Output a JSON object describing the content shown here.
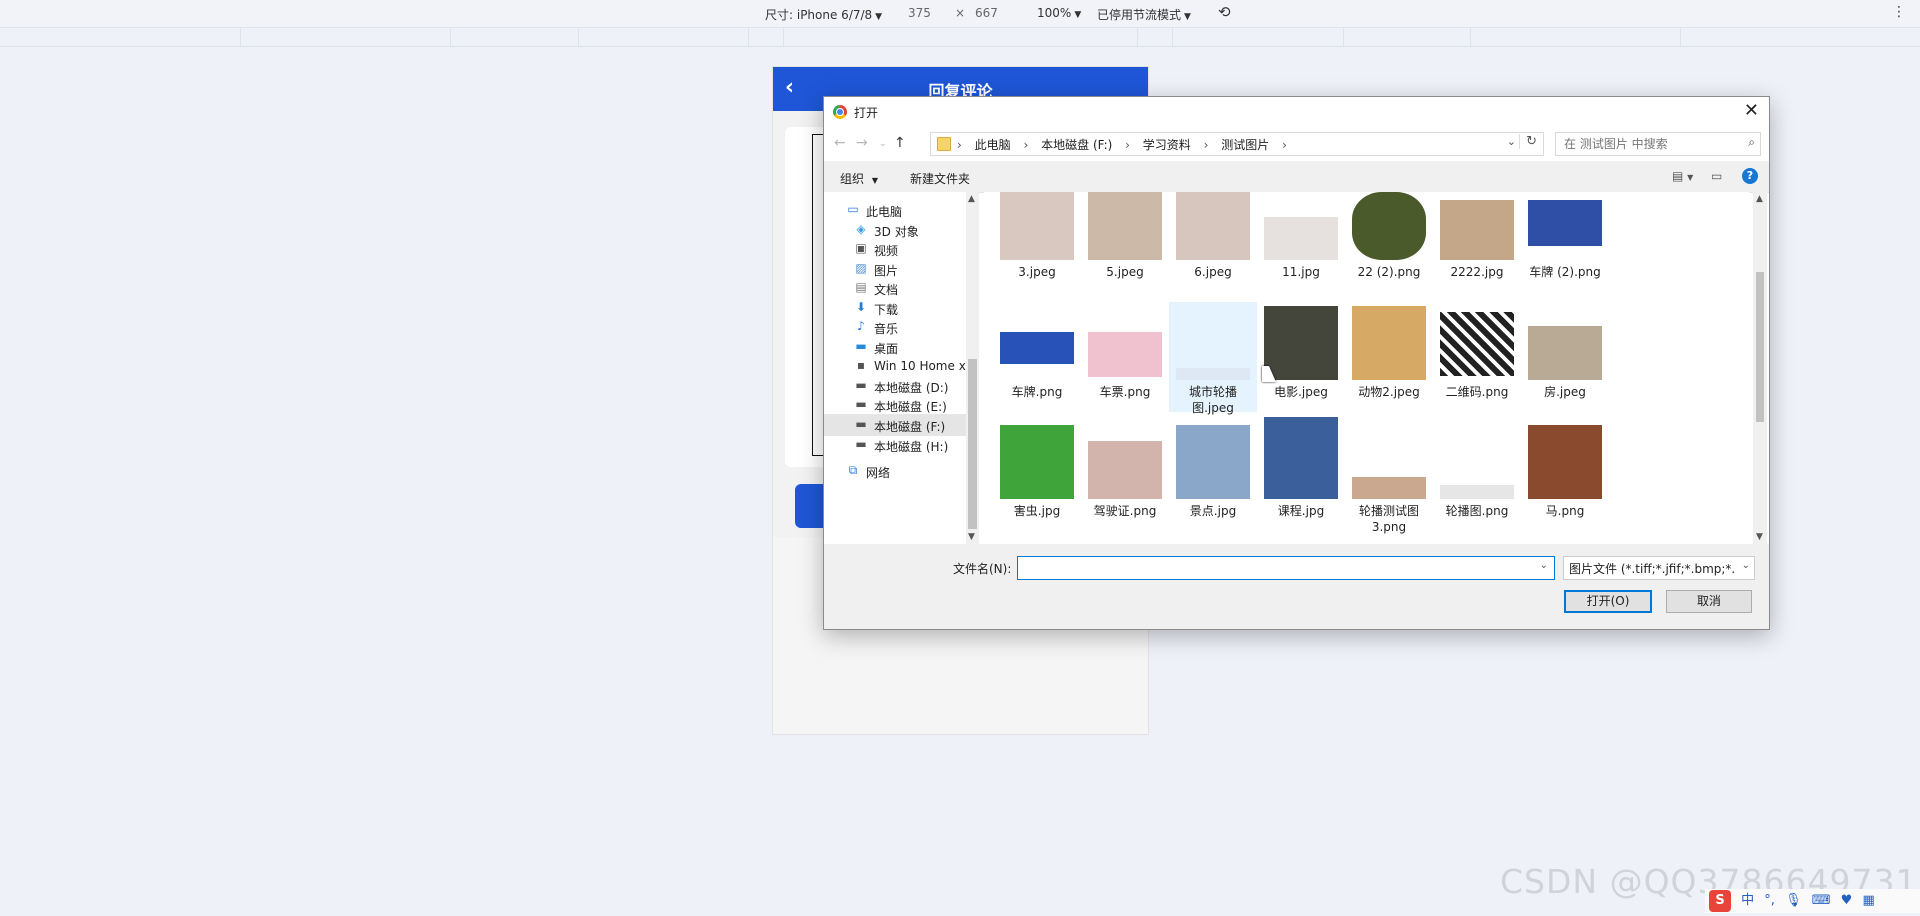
{
  "devtools": {
    "device": "尺寸: iPhone 6/7/8",
    "width": "375",
    "times": "×",
    "height": "667",
    "zoom": "100%",
    "throttle": "已停用节流模式"
  },
  "phone": {
    "title": "回复评论"
  },
  "dialog": {
    "title": "打开",
    "breadcrumbs": [
      "此电脑",
      "本地磁盘 (F:)",
      "学习资料",
      "测试图片"
    ],
    "search_placeholder": "在 测试图片 中搜索",
    "organize": "组织",
    "new_folder": "新建文件夹",
    "help": "?",
    "tree": [
      {
        "label": "此电脑",
        "icon": "computer-icon",
        "indent": 0
      },
      {
        "label": "3D 对象",
        "icon": "3d-objects-icon",
        "indent": 1
      },
      {
        "label": "视频",
        "icon": "video-icon",
        "indent": 1
      },
      {
        "label": "图片",
        "icon": "pictures-icon",
        "indent": 1
      },
      {
        "label": "文档",
        "icon": "documents-icon",
        "indent": 1
      },
      {
        "label": "下载",
        "icon": "download-icon",
        "indent": 1
      },
      {
        "label": "音乐",
        "icon": "music-icon",
        "indent": 1
      },
      {
        "label": "桌面",
        "icon": "desktop-icon",
        "indent": 1
      },
      {
        "label": "Win 10 Home x",
        "icon": "drive-c-icon",
        "indent": 1
      },
      {
        "label": "本地磁盘 (D:)",
        "icon": "drive-icon",
        "indent": 1
      },
      {
        "label": "本地磁盘 (E:)",
        "icon": "drive-icon",
        "indent": 1
      },
      {
        "label": "本地磁盘 (F:)",
        "icon": "drive-icon",
        "indent": 1,
        "selected": true
      },
      {
        "label": "本地磁盘 (H:)",
        "icon": "drive-icon",
        "indent": 1
      },
      {
        "label": "网络",
        "icon": "network-icon",
        "indent": 0
      }
    ],
    "files": [
      {
        "name": "3.jpeg",
        "color": "#d8c8c0"
      },
      {
        "name": "5.jpeg",
        "color": "#cdb9a8"
      },
      {
        "name": "6.jpeg",
        "color": "#d6c6bd"
      },
      {
        "name": "11.jpg",
        "color": "#e6e0de"
      },
      {
        "name": "22 (2).png",
        "color": "#4a5a2a"
      },
      {
        "name": "2222.jpg",
        "color": "#c4a788"
      },
      {
        "name": "车牌 (2).png",
        "color": "#2f4fa6"
      },
      {
        "name": "车牌.png",
        "color": "#2852b8"
      },
      {
        "name": "车票.png",
        "color": "#f0c2cf"
      },
      {
        "name": "城市轮播图.jpeg",
        "color": "#dde8f4",
        "selected": true
      },
      {
        "name": "电影.jpeg",
        "color": "#44463c"
      },
      {
        "name": "动物2.jpeg",
        "color": "#d6a965"
      },
      {
        "name": "二维码.png",
        "color": "#222222"
      },
      {
        "name": "房.jpeg",
        "color": "#b9aa96"
      },
      {
        "name": "害虫.jpg",
        "color": "#3fa53a"
      },
      {
        "name": "驾驶证.png",
        "color": "#d2b4ad"
      },
      {
        "name": "景点.jpg",
        "color": "#8aa6c8"
      },
      {
        "name": "课程.jpg",
        "color": "#3b5f9b"
      },
      {
        "name": "轮播测试图3.png",
        "color": "#c9a88f"
      },
      {
        "name": "轮播图.png",
        "color": "#e6e6e6"
      },
      {
        "name": "马.png",
        "color": "#8a4a2e"
      }
    ],
    "filename_label": "文件名(N):",
    "filename_value": "",
    "filetype": "图片文件 (*.tiff;*.jfif;*.bmp;*.gi",
    "open_button": "打开(O)",
    "cancel_button": "取消"
  },
  "watermark": "CSDN @QQ3786649731",
  "ime": {
    "s": "S",
    "zh": "中"
  }
}
